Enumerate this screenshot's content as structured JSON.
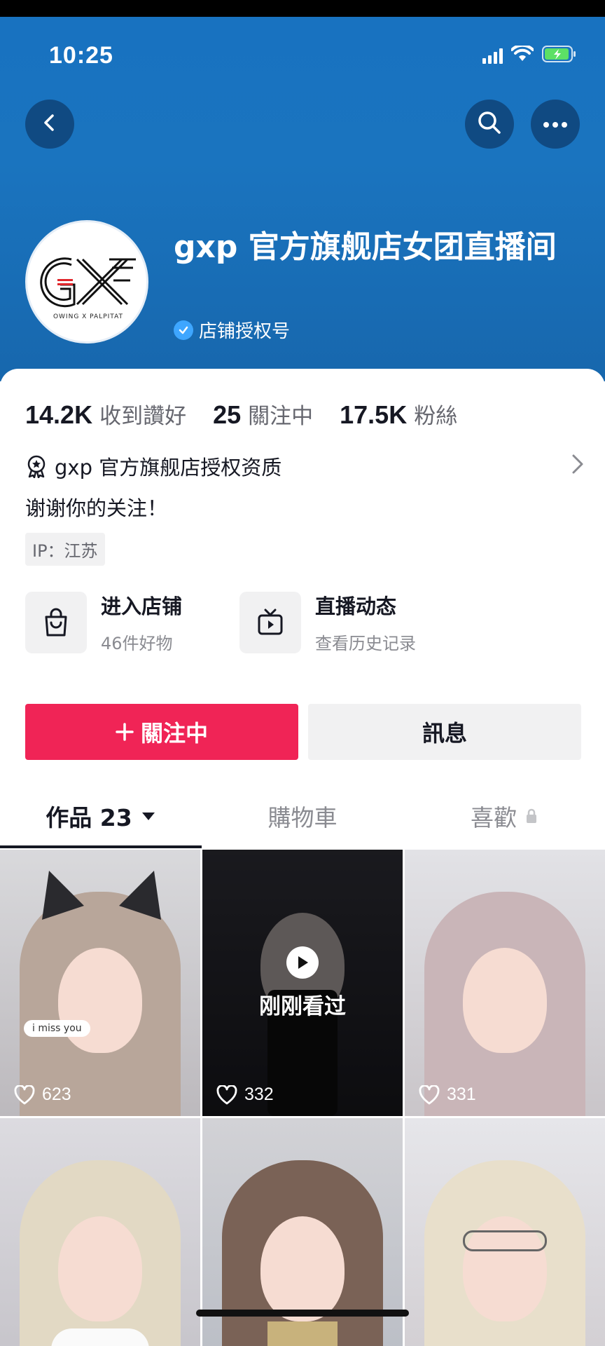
{
  "status_bar": {
    "time": "10:25"
  },
  "nav": {
    "back_icon": "chevron-left-icon",
    "search_icon": "search-icon",
    "more_icon": "more-icon"
  },
  "profile": {
    "name": "gxp 官方旗舰店女团直播间",
    "verification": "店铺授权号",
    "logo_text": "GXP",
    "logo_subtext": "OWING X PALPITAT"
  },
  "stats": [
    {
      "value": "14.2K",
      "label": "收到讚好"
    },
    {
      "value": "25",
      "label": "關注中"
    },
    {
      "value": "17.5K",
      "label": "粉絲"
    }
  ],
  "qualification": "gxp 官方旗舰店授权资质",
  "bio": "谢谢你的关注！",
  "ip": "IP：江苏",
  "entries": [
    {
      "title": "进入店铺",
      "subtitle": "46件好物",
      "icon": "shopping-bag-icon"
    },
    {
      "title": "直播动态",
      "subtitle": "查看历史记录",
      "icon": "tv-icon"
    }
  ],
  "buttons": {
    "follow": "關注中",
    "message": "訊息"
  },
  "tabs": [
    {
      "label": "作品 23",
      "active": true
    },
    {
      "label": "購物車",
      "active": false
    },
    {
      "label": "喜歡",
      "active": false
    }
  ],
  "videos": [
    {
      "likes": "623",
      "sticker": "i miss you"
    },
    {
      "likes": "332",
      "overlay": "刚刚看过"
    },
    {
      "likes": "331"
    },
    {
      "likes": ""
    },
    {
      "likes": ""
    },
    {
      "likes": ""
    }
  ],
  "colors": {
    "header": "#1872c0",
    "accent": "#f02456"
  }
}
